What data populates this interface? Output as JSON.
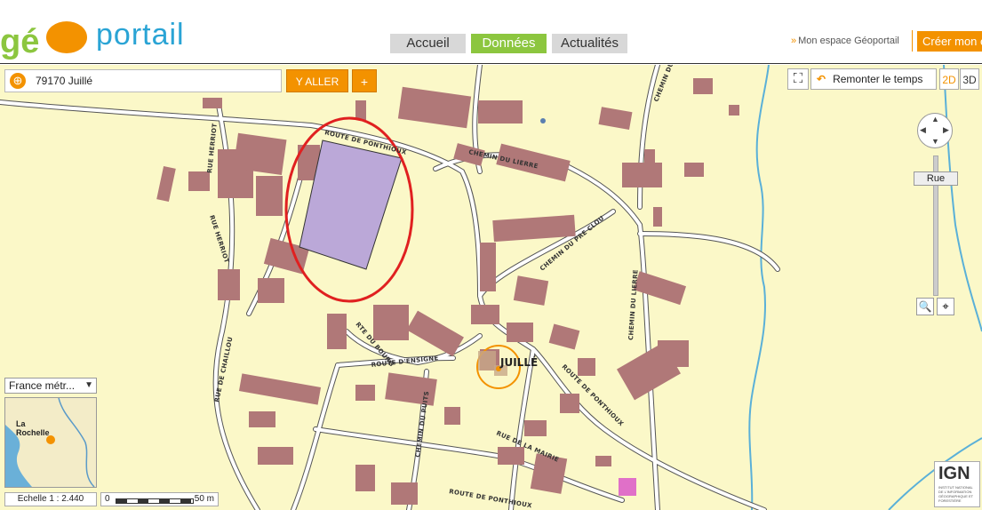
{
  "header": {
    "logo_prefix": "gé",
    "logo_text": "portail",
    "nav": [
      "Accueil",
      "Données",
      "Actualités"
    ],
    "active_nav": "Données",
    "espace_link": "Mon espace Géoportail",
    "create_button": "Créer mon e"
  },
  "search": {
    "value": "79170 Juillé",
    "go_label": "Y ALLER",
    "plus_label": "+"
  },
  "toolbar": {
    "remonter": "Remonter le temps",
    "mode_2d": "2D",
    "mode_3d": "3D"
  },
  "zoom": {
    "level_label": "Rue"
  },
  "overview": {
    "selector": "France métr...",
    "city": "La Rochelle"
  },
  "scale": {
    "text": "Echelle 1 : 2.440",
    "bar_start": "0",
    "bar_end": "50 m"
  },
  "map": {
    "place": "JUILLÉ",
    "streets": [
      "ROUTE DE PONTHIOUX",
      "CHEMIN DU LIERRE",
      "RUE HERRIOT",
      "RUE DE CHAILLOU",
      "RTE DU BOURG",
      "ROUTE D'ENSIGNE",
      "CHEMIN DU PUITS",
      "RUE DE LA MAIRIE",
      "CHEMIN DU PRE CLOU",
      "CHEMIN DU LIERRE",
      "ROUTE DE PONTHIOUX",
      "CHEMIN DU PRE"
    ],
    "colors": {
      "background": "#fbf8c8",
      "building": "#b07878",
      "highlight": "#bba8d8",
      "circle": "#e02020",
      "water": "#5ab0d8"
    }
  },
  "ign": {
    "name": "IGN",
    "subtitle": "INSTITUT NATIONAL DE L'INFORMATION GÉOGRAPHIQUE ET FORESTIÈRE"
  }
}
